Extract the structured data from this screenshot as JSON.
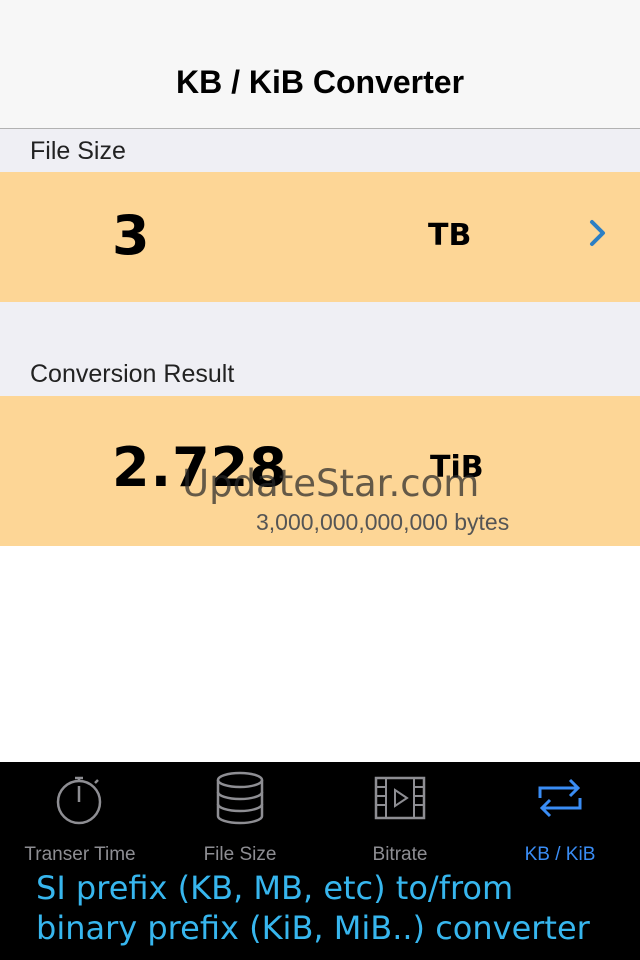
{
  "nav": {
    "title": "KB / KiB Converter"
  },
  "file_size": {
    "header": "File Size",
    "value": "3",
    "unit": "TB"
  },
  "result": {
    "header": "Conversion Result",
    "value": "2.728",
    "unit": "TiB",
    "bytes": "3,000,000,000,000 bytes"
  },
  "watermark": "UpdateStar.com",
  "tabs": [
    {
      "label": "Transer Time",
      "icon": "stopwatch-icon",
      "active": false
    },
    {
      "label": "File Size",
      "icon": "database-icon",
      "active": false
    },
    {
      "label": "Bitrate",
      "icon": "video-film-icon",
      "active": false
    },
    {
      "label": "KB / KiB",
      "icon": "swap-arrows-icon",
      "active": true
    }
  ],
  "caption": {
    "line1": "SI prefix (KB, MB, etc) to/from",
    "line2": "binary prefix (KiB, MiB..) converter"
  },
  "colors": {
    "row_bg": "#fdd696",
    "accent_blue": "#3a8df5",
    "chevron": "#2c7fc4",
    "caption": "#37b6ee"
  }
}
